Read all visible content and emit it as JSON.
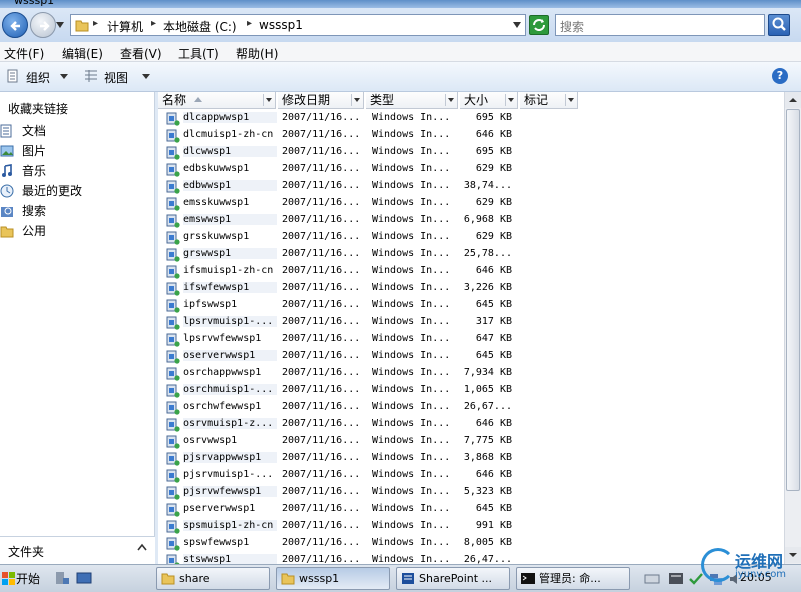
{
  "window": {
    "title": "wsssp1"
  },
  "address": {
    "crumbs": [
      "计算机",
      "本地磁盘 (C:)",
      "wsssp1"
    ],
    "search_placeholder": "搜索"
  },
  "menu": [
    "文件(F)",
    "编辑(E)",
    "查看(V)",
    "工具(T)",
    "帮助(H)"
  ],
  "commands": {
    "organize": "组织",
    "views": "视图"
  },
  "nav": {
    "heading": "收藏夹链接",
    "favorites": [
      {
        "label": "文档",
        "icon": "documents-icon"
      },
      {
        "label": "图片",
        "icon": "pictures-icon"
      },
      {
        "label": "音乐",
        "icon": "music-icon"
      },
      {
        "label": "最近的更改",
        "icon": "recent-changes-icon"
      },
      {
        "label": "搜索",
        "icon": "search-folder-icon"
      },
      {
        "label": "公用",
        "icon": "public-folder-icon"
      }
    ],
    "folders_label": "文件夹"
  },
  "columns": [
    "名称",
    "修改日期",
    "类型",
    "大小",
    "标记"
  ],
  "files": [
    {
      "name": "dlcappwwsp1",
      "date": "2007/11/16...",
      "type": "Windows In...",
      "size": "695 KB"
    },
    {
      "name": "dlcmuisp1-zh-cn",
      "date": "2007/11/16...",
      "type": "Windows In...",
      "size": "646 KB"
    },
    {
      "name": "dlcwwsp1",
      "date": "2007/11/16...",
      "type": "Windows In...",
      "size": "695 KB"
    },
    {
      "name": "edbskuwwsp1",
      "date": "2007/11/16...",
      "type": "Windows In...",
      "size": "629 KB"
    },
    {
      "name": "edbwwsp1",
      "date": "2007/11/16...",
      "type": "Windows In...",
      "size": "38,74..."
    },
    {
      "name": "emsskuwwsp1",
      "date": "2007/11/16...",
      "type": "Windows In...",
      "size": "629 KB"
    },
    {
      "name": "emswwsp1",
      "date": "2007/11/16...",
      "type": "Windows In...",
      "size": "6,968 KB"
    },
    {
      "name": "grsskuwwsp1",
      "date": "2007/11/16...",
      "type": "Windows In...",
      "size": "629 KB"
    },
    {
      "name": "grswwsp1",
      "date": "2007/11/16...",
      "type": "Windows In...",
      "size": "25,78..."
    },
    {
      "name": "ifsmuisp1-zh-cn",
      "date": "2007/11/16...",
      "type": "Windows In...",
      "size": "646 KB"
    },
    {
      "name": "ifswfewwsp1",
      "date": "2007/11/16...",
      "type": "Windows In...",
      "size": "3,226 KB"
    },
    {
      "name": "ipfswwsp1",
      "date": "2007/11/16...",
      "type": "Windows In...",
      "size": "645 KB"
    },
    {
      "name": "lpsrvmuisp1-...",
      "date": "2007/11/16...",
      "type": "Windows In...",
      "size": "317 KB"
    },
    {
      "name": "lpsrvwfewwsp1",
      "date": "2007/11/16...",
      "type": "Windows In...",
      "size": "647 KB"
    },
    {
      "name": "oserverwwsp1",
      "date": "2007/11/16...",
      "type": "Windows In...",
      "size": "645 KB"
    },
    {
      "name": "osrchappwwsp1",
      "date": "2007/11/16...",
      "type": "Windows In...",
      "size": "7,934 KB"
    },
    {
      "name": "osrchmuisp1-...",
      "date": "2007/11/16...",
      "type": "Windows In...",
      "size": "1,065 KB"
    },
    {
      "name": "osrchwfewwsp1",
      "date": "2007/11/16...",
      "type": "Windows In...",
      "size": "26,67..."
    },
    {
      "name": "osrvmuisp1-z...",
      "date": "2007/11/16...",
      "type": "Windows In...",
      "size": "646 KB"
    },
    {
      "name": "osrvwwsp1",
      "date": "2007/11/16...",
      "type": "Windows In...",
      "size": "7,775 KB"
    },
    {
      "name": "pjsrvappwwsp1",
      "date": "2007/11/16...",
      "type": "Windows In...",
      "size": "3,868 KB"
    },
    {
      "name": "pjsrvmuisp1-...",
      "date": "2007/11/16...",
      "type": "Windows In...",
      "size": "646 KB"
    },
    {
      "name": "pjsrvwfewwsp1",
      "date": "2007/11/16...",
      "type": "Windows In...",
      "size": "5,323 KB"
    },
    {
      "name": "pserverwwsp1",
      "date": "2007/11/16...",
      "type": "Windows In...",
      "size": "645 KB"
    },
    {
      "name": "spsmuisp1-zh-cn",
      "date": "2007/11/16...",
      "type": "Windows In...",
      "size": "991 KB"
    },
    {
      "name": "spswfewwsp1",
      "date": "2007/11/16...",
      "type": "Windows In...",
      "size": "8,005 KB"
    },
    {
      "name": "stswwsp1",
      "date": "2007/11/16...",
      "type": "Windows In...",
      "size": "26,47..."
    }
  ],
  "taskbar": {
    "start": "开始",
    "tasks": [
      "share",
      "wsssp1",
      "SharePoint ...",
      "管理员: 命..."
    ],
    "clock": "20:05"
  },
  "watermark": {
    "title": "运维网",
    "sub": "iyunv.com"
  }
}
